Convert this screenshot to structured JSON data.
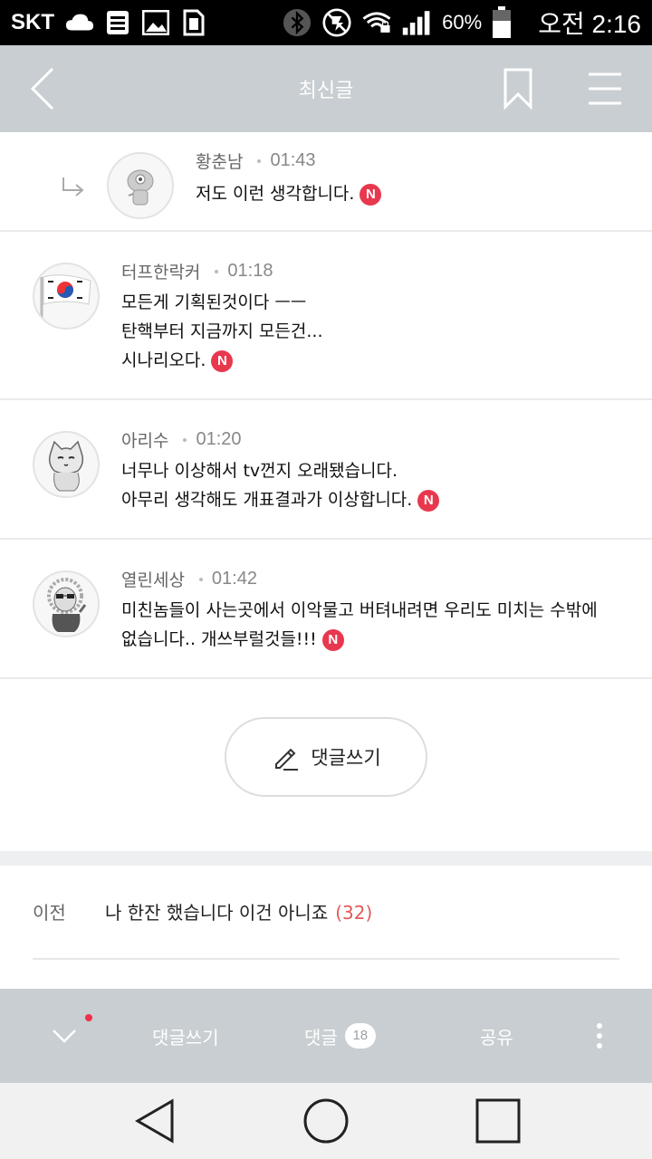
{
  "status_bar": {
    "carrier": "SKT",
    "battery_percent": "60%",
    "clock": "오전 2:16",
    "icons": [
      "cloud-icon",
      "document-icon",
      "image-icon",
      "sim-icon",
      "bluetooth-icon",
      "mute-icon",
      "wifi-lock-icon",
      "signal-icon",
      "battery-icon"
    ]
  },
  "header": {
    "title": "최신글",
    "back_icon": "back-chevron-icon",
    "bookmark_icon": "bookmark-icon",
    "menu_icon": "hamburger-menu-icon"
  },
  "comments": [
    {
      "author": "황춘남",
      "time": "01:43",
      "text": "저도 이런 생각합니다.",
      "is_reply": true,
      "new_badge": "N"
    },
    {
      "author": "터프한락커",
      "time": "01:18",
      "text": "모든게 기획된것이다 ㅡㅡ\n탄핵부터 지금까지 모든건...\n시나리오다.",
      "is_reply": false,
      "new_badge": "N"
    },
    {
      "author": "아리수",
      "time": "01:20",
      "text": "너무나 이상해서 tv껀지 오래됐습니다.\n아무리 생각해도 개표결과가 이상합니다.",
      "is_reply": false,
      "new_badge": "N"
    },
    {
      "author": "열린세상",
      "time": "01:42",
      "text": "미친놈들이 사는곳에서 이악물고 버텨내려면 우리도 미치는 수밖에\n없습니다.. 개쓰부럴것들!!!",
      "is_reply": false,
      "new_badge": "N"
    }
  ],
  "write_button": {
    "label": "댓글쓰기",
    "icon": "pencil-icon"
  },
  "prev_post": {
    "label": "이전",
    "title": "나 한잔 했습니다 이건 아니죠",
    "count": "(32)"
  },
  "action_bar": {
    "write_label": "댓글쓰기",
    "comments_label": "댓글",
    "comments_count": "18",
    "share_label": "공유"
  },
  "colors": {
    "header_bg": "#c8ced1",
    "new_badge": "#e8384e",
    "count_red": "#e15a5a"
  }
}
